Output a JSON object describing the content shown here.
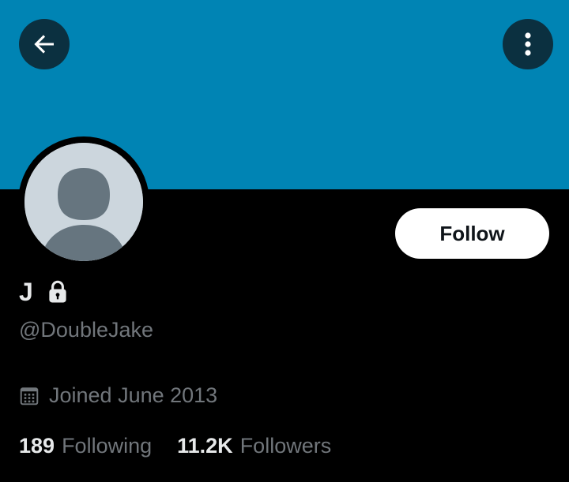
{
  "colors": {
    "banner": "#0084b4",
    "background": "#000000",
    "primary_text": "#e7e9ea",
    "secondary_text": "#71767b",
    "follow_button_bg": "#ffffff"
  },
  "header": {
    "back_icon": "arrow-left-icon",
    "more_icon": "vertical-dots-icon"
  },
  "profile": {
    "display_name": "J",
    "protected_icon": "lock-icon",
    "handle": "@DoubleJake",
    "joined_icon": "calendar-icon",
    "joined": "Joined June 2013",
    "follow_label": "Follow"
  },
  "stats": {
    "following_count": "189",
    "following_label": "Following",
    "followers_count": "11.2K",
    "followers_label": "Followers"
  }
}
